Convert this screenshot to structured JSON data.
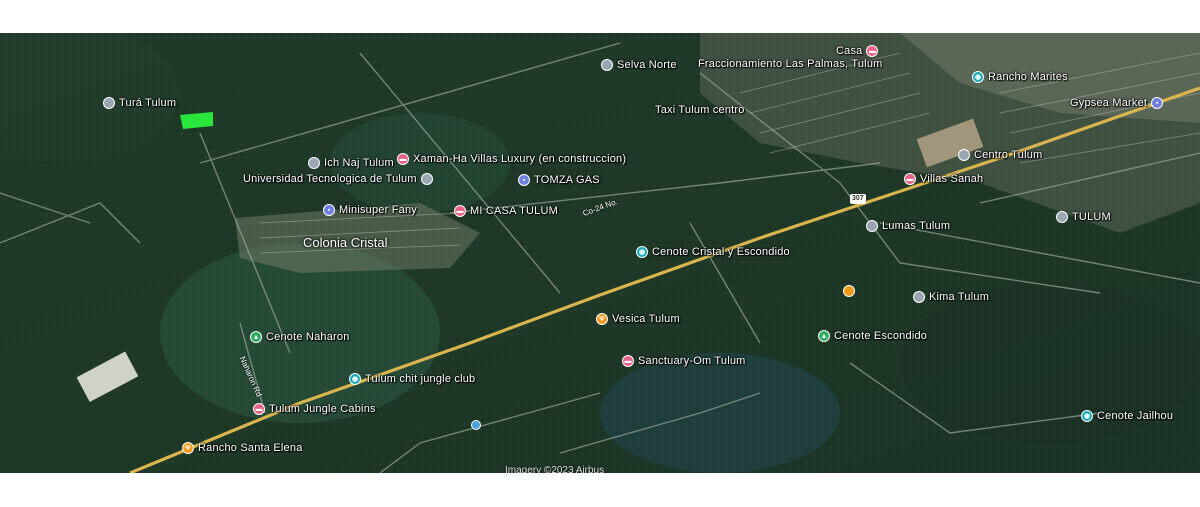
{
  "colors": {
    "poi_gray": "#9aa6b2",
    "poi_pink": "#e8628a",
    "poi_blue": "#6f7fe0",
    "poi_teal": "#19a9b8",
    "poi_green": "#2fae62",
    "poi_orange": "#f29a1a",
    "parcel": "#29e63d",
    "highway": "#d9b54f"
  },
  "places": [
    {
      "id": "tura-tulum",
      "label": "Turá Tulum",
      "icon": "pin-icon",
      "color": "gray"
    },
    {
      "id": "ich-naj",
      "label": "Ich Naj Tulum",
      "icon": "pin-icon",
      "color": "gray"
    },
    {
      "id": "xaman-ha",
      "label": "Xaman-Ha Villas Luxury (en construccion)",
      "icon": "hotel-icon",
      "color": "pink"
    },
    {
      "id": "universidad",
      "label": "Universidad Tecnologica de Tulum",
      "icon": "school-icon",
      "color": "gray"
    },
    {
      "id": "tomza",
      "label": "TOMZA GAS",
      "icon": "gas-icon",
      "color": "blue"
    },
    {
      "id": "minisuper",
      "label": "Minisuper Fany",
      "icon": "shop-icon",
      "color": "blue"
    },
    {
      "id": "mi-casa",
      "label": "MI CASA TULUM",
      "icon": "hotel-icon",
      "color": "pink"
    },
    {
      "id": "cenote-cristal",
      "label": "Cenote Cristal y Escondido",
      "icon": "camera-icon",
      "color": "teal"
    },
    {
      "id": "vesica",
      "label": "Vesica Tulum",
      "icon": "restaurant-icon",
      "color": "orange"
    },
    {
      "id": "sanctuary",
      "label": "Sanctuary-Om Tulum",
      "icon": "hotel-icon",
      "color": "pink"
    },
    {
      "id": "cenote-escondido",
      "label": "Cenote Escondido",
      "icon": "park-icon",
      "color": "green"
    },
    {
      "id": "kima",
      "label": "Kima Tulum",
      "icon": "pin-icon",
      "color": "gray"
    },
    {
      "id": "lumas",
      "label": "Lumas Tulum",
      "icon": "pin-icon",
      "color": "gray"
    },
    {
      "id": "villas-sanah",
      "label": "Villas Sanah",
      "icon": "hotel-icon",
      "color": "pink"
    },
    {
      "id": "centro-tulum",
      "label": "Centro Tulum",
      "icon": "pin-icon",
      "color": "gray"
    },
    {
      "id": "tulum-city",
      "label": "TULUM",
      "icon": "pin-icon",
      "color": "gray"
    },
    {
      "id": "cenote-jailhouse",
      "label": "Cenote Jailhou",
      "icon": "camera-icon",
      "color": "teal"
    },
    {
      "id": "cenote-naharon",
      "label": "Cenote Naharon",
      "icon": "park-icon",
      "color": "green"
    },
    {
      "id": "tulum-chit",
      "label": "Tulum chit jungle club",
      "icon": "camera-icon",
      "color": "teal"
    },
    {
      "id": "jungle-cabins",
      "label": "Tulum Jungle Cabins",
      "icon": "hotel-icon",
      "color": "pink"
    },
    {
      "id": "rancho-santa-elena",
      "label": "Rancho Santa Elena",
      "icon": "restaurant-icon",
      "color": "orange"
    },
    {
      "id": "rancho-marites",
      "label": "Rancho Marites",
      "icon": "camera-icon",
      "color": "teal"
    },
    {
      "id": "gypsea",
      "label": "Gypsea Market",
      "icon": "shop-icon",
      "color": "blue"
    },
    {
      "id": "casa",
      "label": "Casa",
      "icon": "hotel-icon",
      "color": "pink"
    },
    {
      "id": "fraccionamiento",
      "label": "Fraccionamiento Las Palmas, Tulum",
      "icon": "none",
      "color": "gray"
    },
    {
      "id": "selva-norte",
      "label": "Selva Norte",
      "icon": "pin-icon",
      "color": "gray"
    },
    {
      "id": "taxi-tulum",
      "label": "Taxi Tulum centro",
      "icon": "none",
      "color": "gray"
    }
  ],
  "areas": {
    "colonia_cristal": "Colonia Cristal"
  },
  "roads": {
    "naharon_rd": "Naharon Rd",
    "highway_shield": "307",
    "side_road": "Co-24 No."
  },
  "attribution": "Imagery ©2023 Airbus"
}
